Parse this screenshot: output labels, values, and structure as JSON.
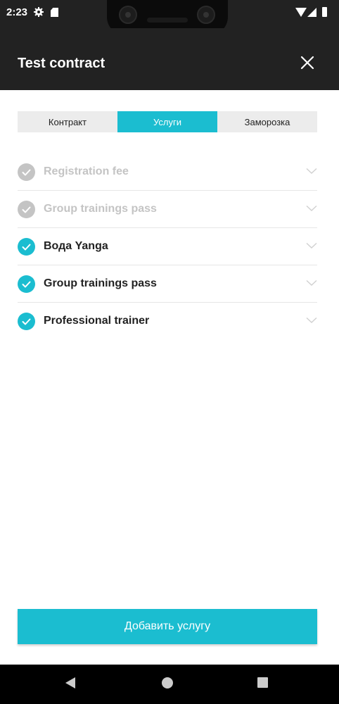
{
  "status_bar": {
    "time": "2:23",
    "icons": [
      "gear-icon",
      "sd-card-icon",
      "wifi-icon",
      "signal-icon",
      "battery-icon"
    ]
  },
  "app_bar": {
    "title": "Test contract",
    "close_icon": "close-icon"
  },
  "tabs": [
    {
      "label": "Контракт",
      "active": false
    },
    {
      "label": "Услуги",
      "active": true
    },
    {
      "label": "Заморозка",
      "active": false
    }
  ],
  "services": [
    {
      "label": "Registration fee",
      "checked": false
    },
    {
      "label": "Group trainings pass",
      "checked": false
    },
    {
      "label": "Вода Yanga",
      "checked": true
    },
    {
      "label": "Group trainings pass",
      "checked": true
    },
    {
      "label": "Professional trainer",
      "checked": true
    }
  ],
  "add_button": {
    "label": "Добавить услугу"
  },
  "colors": {
    "accent": "#1bbdd0",
    "header_bg": "#222222",
    "inactive": "#c4c4c4",
    "tab_bg": "#ececec"
  },
  "nav_bar": {
    "icons": [
      "back-icon",
      "home-icon",
      "recents-icon"
    ]
  }
}
